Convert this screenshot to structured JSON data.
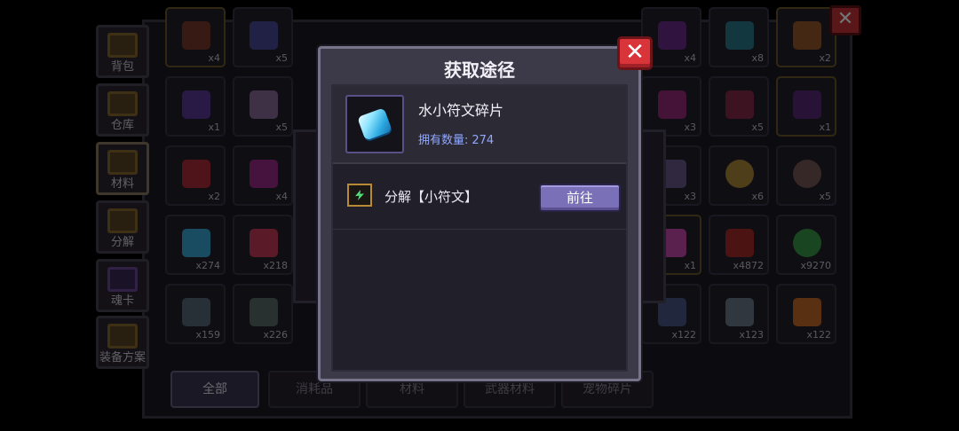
{
  "dialog": {
    "title": "获取途径",
    "close_label": "✕",
    "item_name": "水小符文碎片",
    "own_label": "拥有数量:",
    "own_value": "274",
    "source_label": "分解【小符文】",
    "go_label": "前往"
  },
  "inventory": {
    "close_label": "✕",
    "side_tabs": [
      "背包",
      "仓库",
      "材料",
      "分解",
      "魂卡",
      "装备方案"
    ],
    "bottom_tabs": [
      "全部",
      "消耗品",
      "材料",
      "武器材料",
      "宠物碎片"
    ],
    "counts": {
      "r1c1": "x4",
      "r1c2": "x5",
      "r1c8": "x4",
      "r1c9": "x8",
      "r1c10": "x2",
      "r2c1": "x1",
      "r2c2": "x5",
      "r2c8": "x3",
      "r2c9": "x5",
      "r2c10": "x1",
      "r3c1": "x2",
      "r3c2": "x4",
      "r3c8": "x3",
      "r3c9": "x6",
      "r3c10": "x5",
      "r4c1": "x274",
      "r4c2": "x218",
      "r4c8": "x1",
      "r4c9": "x4872",
      "r4c10": "x9270",
      "r5c1": "x159",
      "r5c2": "x226",
      "r5c8": "x122",
      "r5c9": "x123",
      "r5c10": "x122"
    }
  },
  "colors": {
    "accent_button": "#7a70b8",
    "close_red": "#d8343a",
    "own_text": "#8fa8ff"
  },
  "icons": [
    "crystal-shard-icon",
    "decompose-icon",
    "close-icon"
  ]
}
